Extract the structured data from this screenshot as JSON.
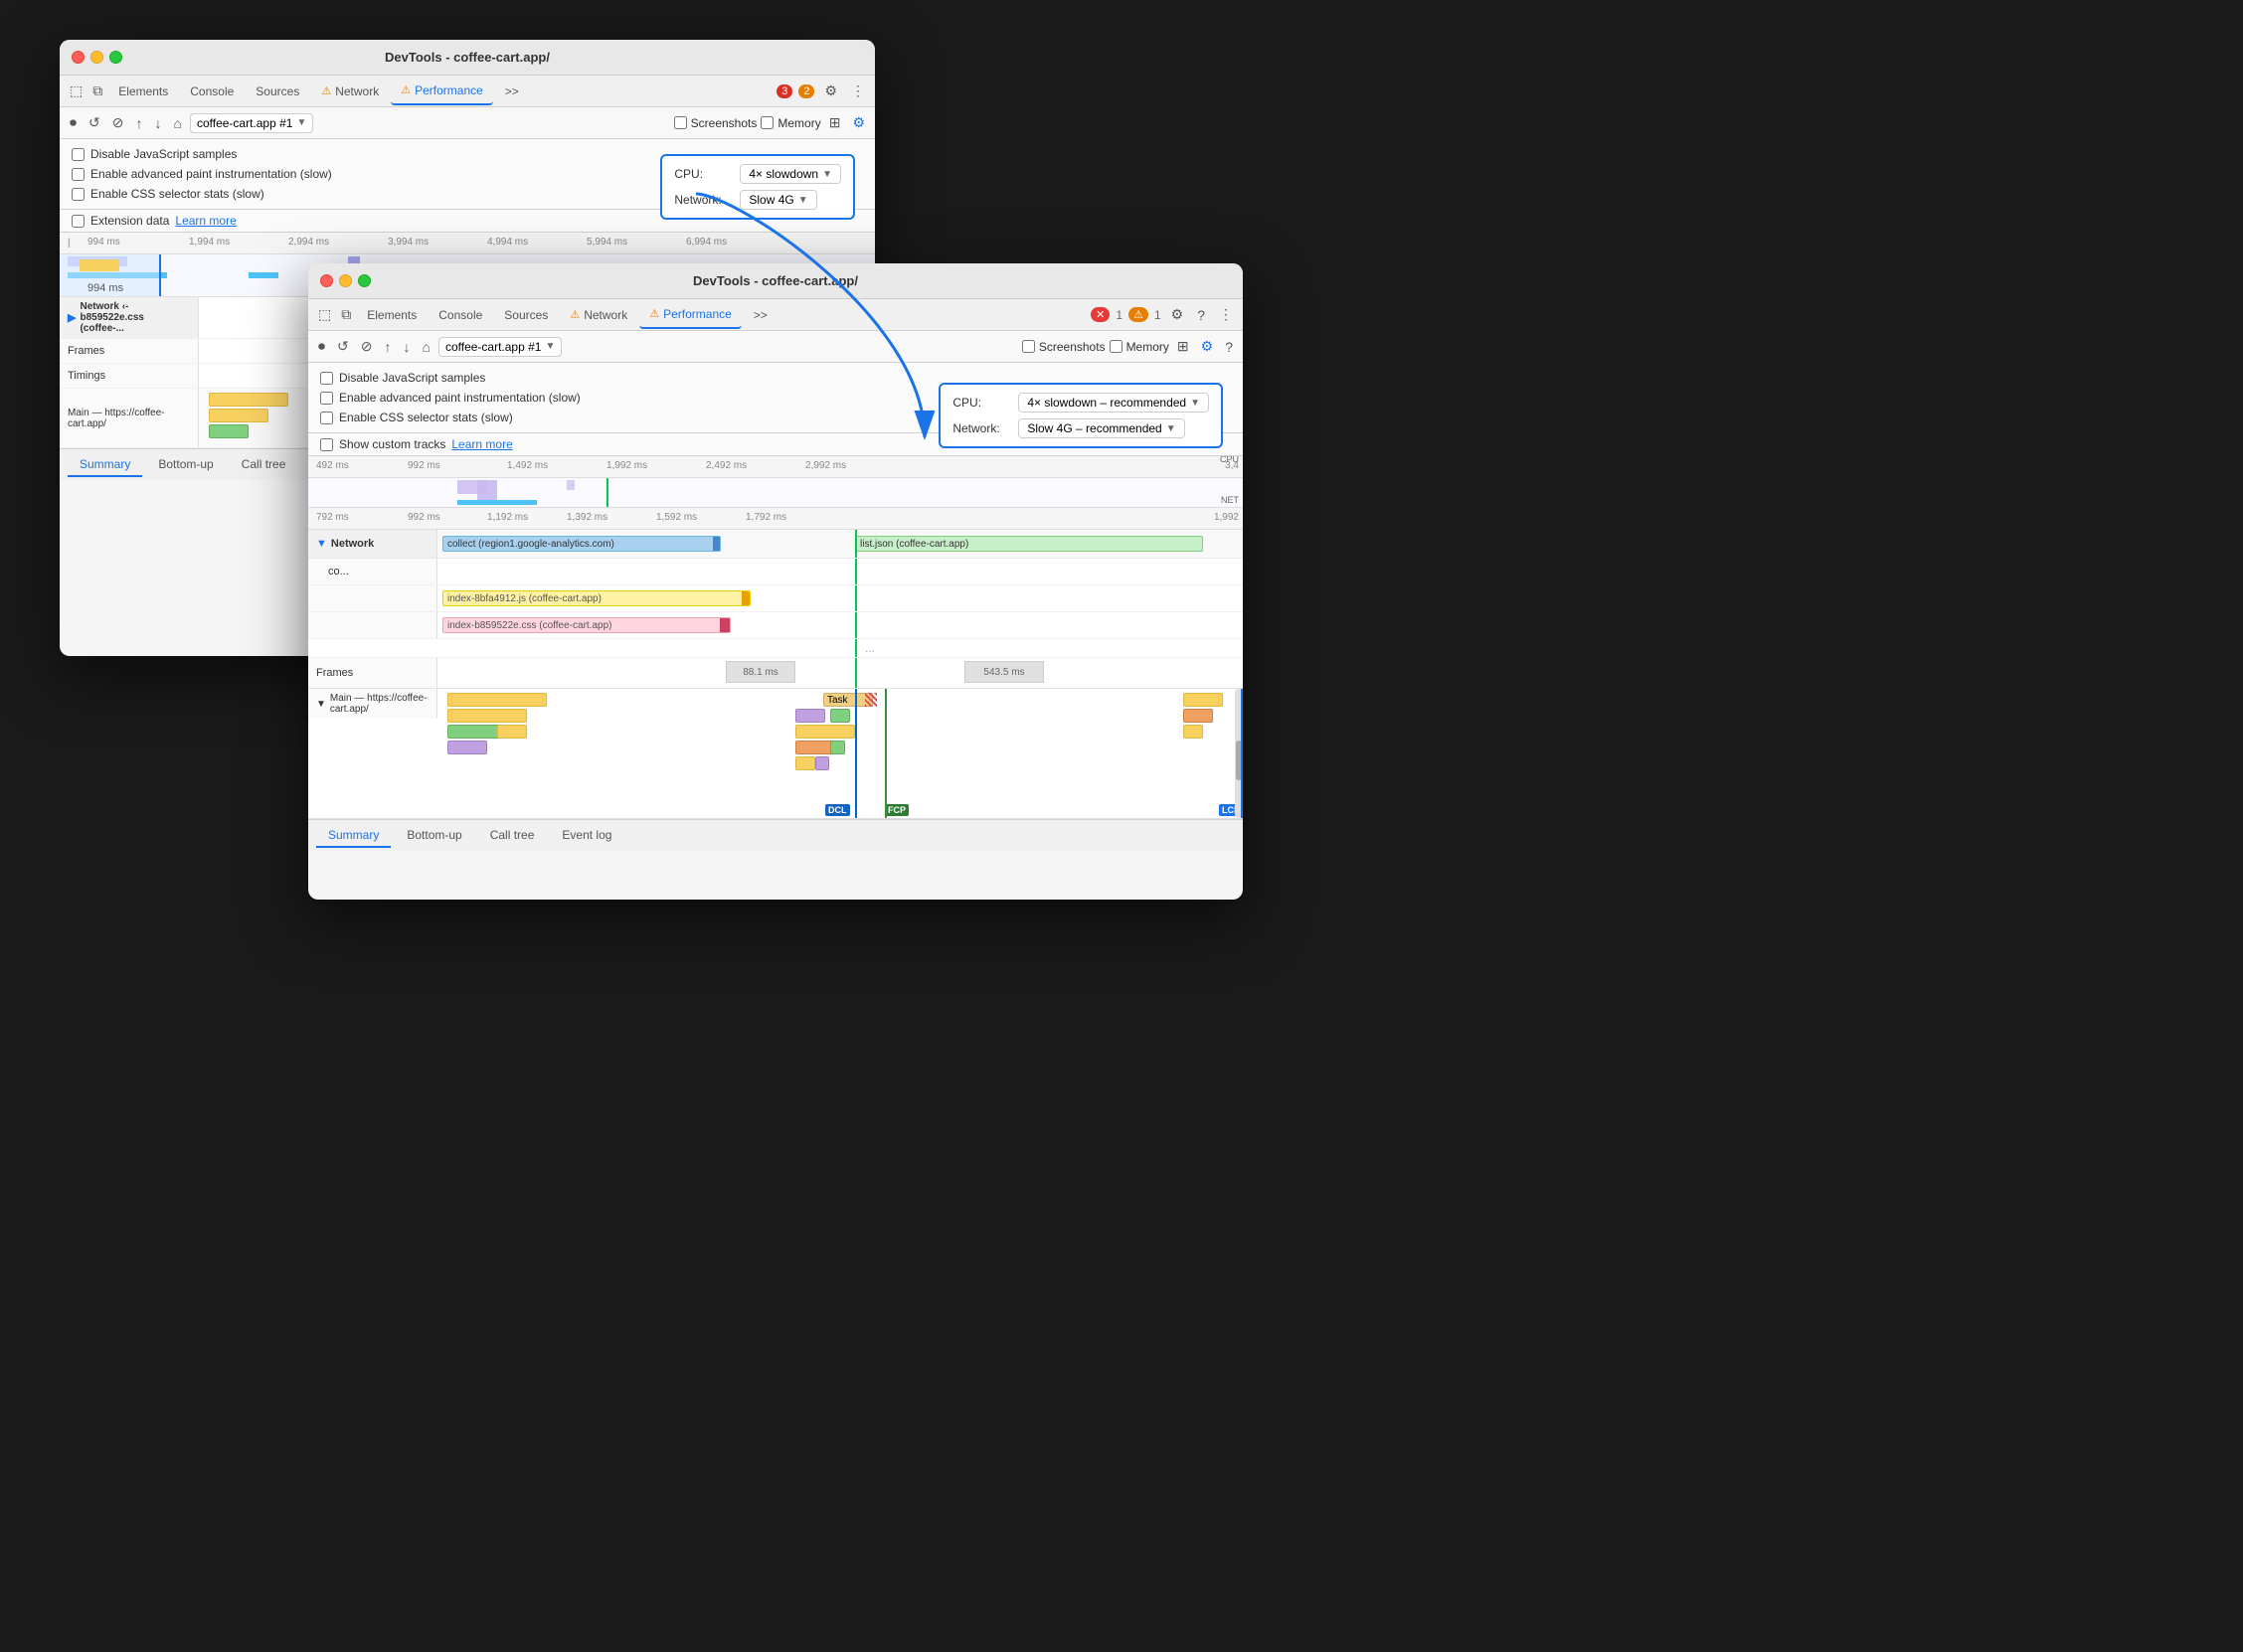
{
  "window_back": {
    "title": "DevTools - coffee-cart.app/",
    "tabs": [
      "Elements",
      "Console",
      "Sources",
      "Network",
      "Performance",
      ">>"
    ],
    "network_tab_label": "Network",
    "performance_tab_label": "Performance",
    "alerts": {
      "red": "3",
      "orange": "2"
    },
    "target": "coffee-cart.app #1",
    "checkboxes": {
      "screenshots": "Screenshots",
      "memory": "Memory"
    },
    "settings": {
      "disable_js": "Disable JavaScript samples",
      "advanced_paint": "Enable advanced paint instrumentation (slow)",
      "css_selector": "Enable CSS selector stats (slow)",
      "extension_data": "Extension data",
      "learn_more": "Learn more"
    },
    "throttle": {
      "cpu_label": "CPU:",
      "cpu_value": "4× slowdown",
      "network_label": "Network:",
      "network_value": "Slow 4G"
    },
    "ruler": [
      "994 ms",
      "1,994 ms",
      "2,994 ms",
      "3,994 ms",
      "4,994 ms",
      "5,994 ms",
      "6,994 ms"
    ],
    "ruler_current": "994 ms",
    "tracks": {
      "network_section": "Network ‹-b859522e.css (coffee-...",
      "frames": "Frames",
      "timings": "Timings",
      "main": "Main — https://coffee-cart.app/"
    },
    "bottom_tabs": [
      "Summary",
      "Bottom-up",
      "Call tree"
    ],
    "active_bottom_tab": "Summary"
  },
  "window_front": {
    "title": "DevTools - coffee-cart.app/",
    "tabs": {
      "elements": "Elements",
      "console": "Console",
      "sources": "Sources",
      "network": "Network",
      "performance": "Performance",
      "more": ">>"
    },
    "alerts": {
      "red": "1",
      "orange": "1"
    },
    "target": "coffee-cart.app #1",
    "checkboxes": {
      "screenshots": "Screenshots",
      "memory": "Memory"
    },
    "settings": {
      "disable_js": "Disable JavaScript samples",
      "advanced_paint": "Enable advanced paint instrumentation (slow)",
      "css_selector": "Enable CSS selector stats (slow)",
      "show_custom": "Show custom tracks",
      "learn_more": "Learn more"
    },
    "throttle": {
      "cpu_label": "CPU:",
      "cpu_value": "4× slowdown – recommended",
      "network_label": "Network:",
      "network_value": "Slow 4G – recommended"
    },
    "ruler_top": [
      "492 ms",
      "992 ms",
      "1,492 ms",
      "1,992 ms",
      "2,492 ms",
      "2,992 ms",
      "3,4"
    ],
    "ruler_labels_right": [
      "CPU",
      "NET"
    ],
    "ruler_bottom": [
      "792 ms",
      "992 ms",
      "1,192 ms",
      "1,392 ms",
      "1,592 ms",
      "1,792 ms",
      "1,992"
    ],
    "tracks": {
      "network_section": "Network",
      "co_label": "co...",
      "collect_bar": "collect (region1.google-analytics.com)",
      "list_json": "list.json (coffee-cart.app)",
      "index_js": "index-8bfa4912.js (coffee-cart.app)",
      "index_css": "index-b859522e.css (coffee-cart.app)",
      "frames": "Frames",
      "frame_1": "88.1 ms",
      "frame_2": "543.5 ms",
      "main": "Main — https://coffee-cart.app/",
      "task_label": "Task"
    },
    "markers": {
      "dcl": "DCL",
      "fcp": "FCP",
      "lcp": "LCP"
    },
    "bottom_tabs": [
      "Summary",
      "Bottom-up",
      "Call tree",
      "Event log"
    ],
    "active_bottom_tab": "Summary"
  },
  "arrow": {
    "label": "blue annotation arrow from window 1 throttle box to window 2 throttle box"
  }
}
